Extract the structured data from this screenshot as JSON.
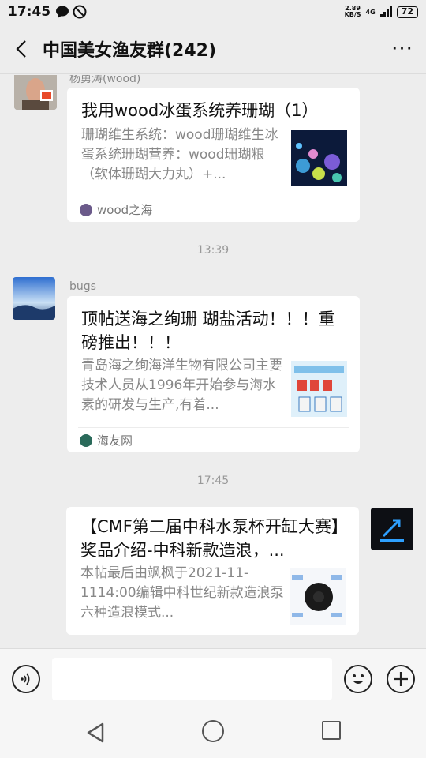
{
  "status_bar": {
    "time": "17:45",
    "net_speed_value": "2.89",
    "net_speed_unit": "KB/S",
    "network_type": "4G",
    "battery": "72"
  },
  "header": {
    "title": "中国美女渔友群(242)",
    "more_label": "···"
  },
  "messages": [
    {
      "sender": "杨勇涛(wood)",
      "title": "我用wood冰蛋系统养珊瑚（1）",
      "desc": "珊瑚维生系统：wood珊瑚维生冰蛋系统珊瑚营养：wood珊瑚粮（软体珊瑚大力丸）+...",
      "source": "wood之海"
    },
    {
      "time": "13:39",
      "sender": "bugs",
      "title": "顶帖送海之绚珊 瑚盐活动！！！重磅推出！！！",
      "desc": "青岛海之绚海洋生物有限公司主要技术人员从1996年开始参与海水素的研发与生产,有着...",
      "source": "海友网"
    },
    {
      "time": "17:45",
      "title": "【CMF第二届中科水泵杯开缸大赛】奖品介绍-中科新款造浪，...",
      "desc": "本帖最后由飒枫于2021-11-1114:00编辑中科世纪新款造浪泵六种造浪模式..."
    }
  ],
  "colors": {
    "background": "#ededed",
    "card": "#ffffff",
    "input_bar": "#f6f6f6"
  }
}
